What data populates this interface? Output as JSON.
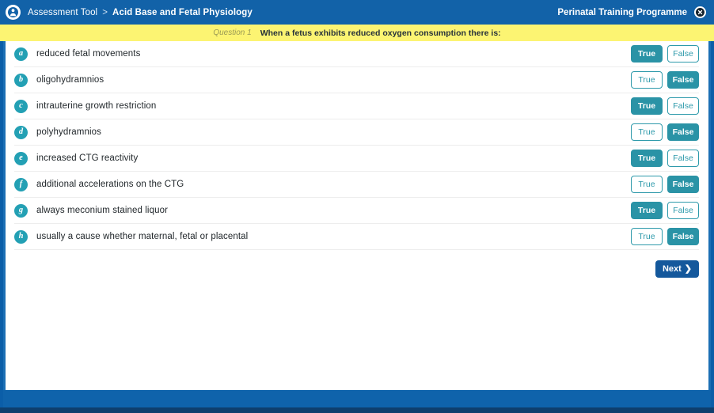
{
  "header": {
    "brand_icon": "perinatal-badge-icon",
    "breadcrumb_root": "Assessment Tool",
    "breadcrumb_separator": ">",
    "breadcrumb_current": "Acid Base and Fetal Physiology",
    "programme": "Perinatal Training Programme",
    "close_icon": "close-icon"
  },
  "question": {
    "label": "Question 1",
    "text": "When a fetus exhibits reduced oxygen consumption there is:"
  },
  "options": [
    {
      "letter": "a",
      "text": "reduced fetal movements",
      "true_label": "True",
      "false_label": "False",
      "selected": "true"
    },
    {
      "letter": "b",
      "text": "oligohydramnios",
      "true_label": "True",
      "false_label": "False",
      "selected": "false"
    },
    {
      "letter": "c",
      "text": "intrauterine growth restriction",
      "true_label": "True",
      "false_label": "False",
      "selected": "true"
    },
    {
      "letter": "d",
      "text": "polyhydramnios",
      "true_label": "True",
      "false_label": "False",
      "selected": "false"
    },
    {
      "letter": "e",
      "text": "increased CTG reactivity",
      "true_label": "True",
      "false_label": "False",
      "selected": "true"
    },
    {
      "letter": "f",
      "text": "additional accelerations on the CTG",
      "true_label": "True",
      "false_label": "False",
      "selected": "false"
    },
    {
      "letter": "g",
      "text": "always meconium stained liquor",
      "true_label": "True",
      "false_label": "False",
      "selected": "true"
    },
    {
      "letter": "h",
      "text": "usually a cause whether maternal, fetal or placental",
      "true_label": "True",
      "false_label": "False",
      "selected": "false"
    }
  ],
  "next": {
    "label": "Next",
    "chevron": "❯",
    "icon": "chevron-right-icon"
  },
  "colors": {
    "header_blue": "#1262a8",
    "banner_yellow": "#fcf472",
    "teal": "#2a93a6",
    "next_blue": "#14589c",
    "footer_blue": "#0f63ab",
    "footer_edge": "#0e3f6e"
  }
}
